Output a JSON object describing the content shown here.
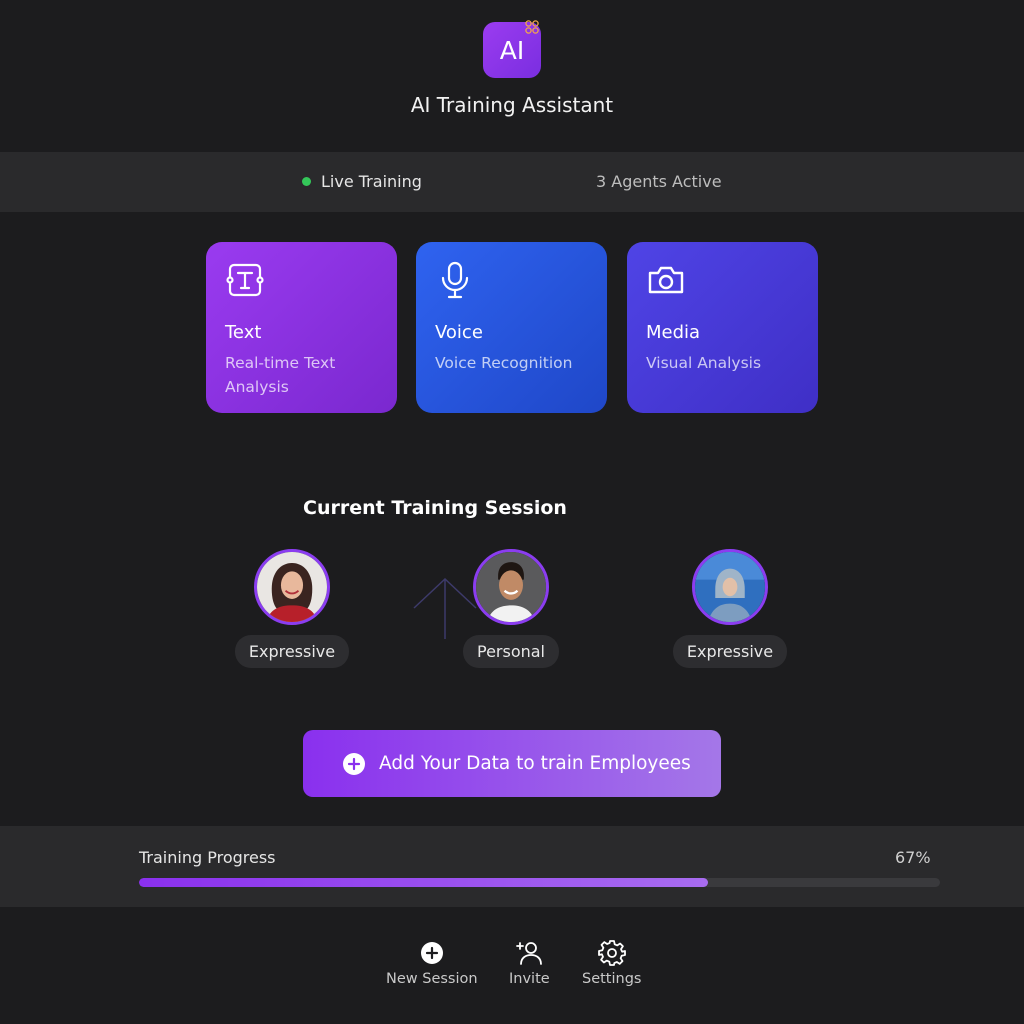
{
  "header": {
    "logo_text": "AI",
    "title": "AI Training Assistant",
    "accent": "#8b3df0"
  },
  "status": {
    "live_label": "Live Training",
    "live_color": "#34c759",
    "agents_label": "3 Agents Active"
  },
  "modes": [
    {
      "icon": "text-cursor-icon",
      "title": "Text",
      "subtitle": "Real-time Text Analysis",
      "color": "#9a3bf0"
    },
    {
      "icon": "microphone-icon",
      "title": "Voice",
      "subtitle": "Voice Recognition",
      "color": "#2f63f0"
    },
    {
      "icon": "camera-icon",
      "title": "Media",
      "subtitle": "Visual Analysis",
      "color": "#4f44e6"
    }
  ],
  "session": {
    "title": "Current Training Session",
    "agents": [
      {
        "tag": "Expressive",
        "avatar": "woman-red-top-avatar"
      },
      {
        "tag": "Personal",
        "avatar": "smiling-man-avatar"
      },
      {
        "tag": "Expressive",
        "avatar": "hooded-person-avatar"
      }
    ]
  },
  "cta": {
    "icon": "plus-circle-icon",
    "label": "Add Your Data to train Employees"
  },
  "progress": {
    "label": "Training Progress",
    "value_text": "67%",
    "fraction": 0.71
  },
  "nav": [
    {
      "icon": "plus-circle-icon",
      "label": "New Session"
    },
    {
      "icon": "add-user-icon",
      "label": "Invite"
    },
    {
      "icon": "gear-icon",
      "label": "Settings"
    }
  ]
}
